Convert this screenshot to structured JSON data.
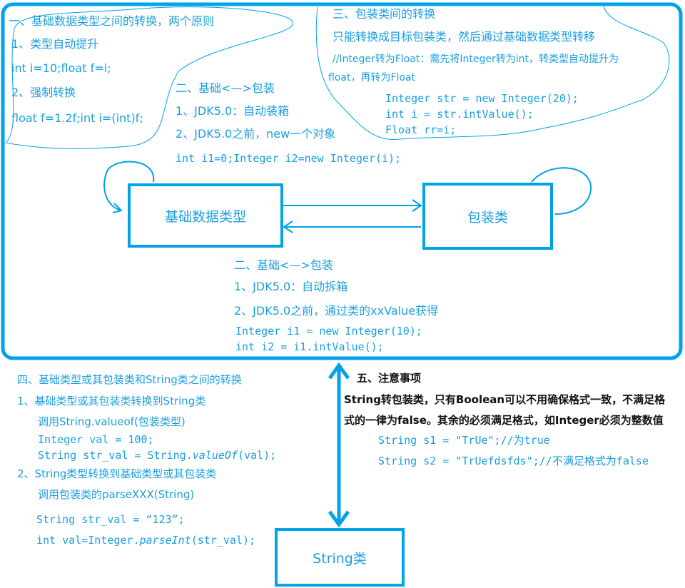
{
  "colors": {
    "frame": "#00a2e8",
    "text": "#1a9ee0",
    "note": "#111111"
  },
  "boxes": {
    "primitive": "基础数据类型",
    "wrapper": "包装类",
    "string": "String类"
  },
  "section1": {
    "title": "一、基础数据类型之间的转换，两个原则",
    "item1": "1、类型自动提升",
    "code1": "int i=10;float f=i;",
    "item2": "2、强制转换",
    "code2": "float f=1.2f;int i=(int)f;"
  },
  "section2a": {
    "title": "二、基础<—>包装",
    "item1": "1、JDK5.0：自动装箱",
    "item2": "2、JDK5.0之前，new一个对象",
    "code": "int i1=0;Integer i2=new Integer(i);"
  },
  "section3": {
    "title": "三、包装类间的转换",
    "desc": "只能转换成目标包装类，然后通过基础数据类型转移",
    "comment1": "//Integer转为Float：需先将Integer转为int，转类型自动提升为",
    "comment2": "float，再转为Float",
    "code": [
      "Integer str = new Integer(20);",
      "int i = str.intValue();",
      "Float rr=i;"
    ]
  },
  "section2b": {
    "title": "二、基础<—>包装",
    "item1": "1、JDK5.0：自动拆箱",
    "item2": "2、JDK5.0之前，通过类的xxValue获得",
    "code": [
      "Integer i1 = new Integer(10);",
      "int i2 = i1.intValue();"
    ]
  },
  "section4": {
    "title": "四、基础类型或其包装类和String类之间的转换",
    "item1": "1、基础类型或其包装类转换到String类",
    "call1": "调用String.valueof(包装类型)",
    "code1a": "Integer val = 100;",
    "code1b_pre": "String str_val = String.",
    "code1b_it": "valueOf",
    "code1b_post": "(val);",
    "item2": "2、String类型转换到基础类型或其包装类",
    "call2": "调用包装类的parseXXX(String)",
    "code2a": "String str_val = “123”;",
    "code2b_pre": "int val=Integer.",
    "code2b_it": "parseInt",
    "code2b_post": "(str_val);"
  },
  "section5": {
    "title": "五、注意事项",
    "line1": "String转包装类，只有Boolean可以不用确保格式一致，不满足格",
    "line2": "式的一律为false。其余的必须满足格式，如Integer必须为整数值",
    "code": [
      "String s1 = \"TrUe\";//为true",
      "String s2 = \"TrUefdsfds\";//不满足格式为false"
    ]
  }
}
